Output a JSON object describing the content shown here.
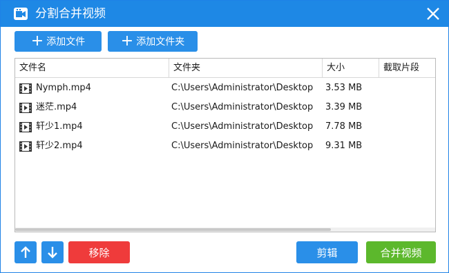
{
  "window": {
    "title": "分割合并视频",
    "accent_color": "#1e88e5",
    "icon": "app-video-icon",
    "close_icon": "close-icon"
  },
  "toolbar": {
    "add_file_label": "添加文件",
    "add_folder_label": "添加文件夹",
    "plus_glyph": "+"
  },
  "table": {
    "columns": [
      "文件名",
      "文件夹",
      "大小",
      "截取片段"
    ],
    "rows": [
      {
        "name": "Nymph.mp4",
        "folder": "C:\\Users\\Administrator\\Desktop",
        "size": "3.53 MB",
        "clip": ""
      },
      {
        "name": "迷茫.mp4",
        "folder": "C:\\Users\\Administrator\\Desktop",
        "size": "3.39 MB",
        "clip": ""
      },
      {
        "name": "轩少1.mp4",
        "folder": "C:\\Users\\Administrator\\Desktop",
        "size": "7.78 MB",
        "clip": ""
      },
      {
        "name": "轩少2.mp4",
        "folder": "C:\\Users\\Administrator\\Desktop",
        "size": "9.31 MB",
        "clip": ""
      }
    ],
    "row_icon": "video-file-icon"
  },
  "footer": {
    "up_icon": "arrow-up-icon",
    "down_icon": "arrow-down-icon",
    "remove_label": "移除",
    "edit_label": "剪辑",
    "merge_label": "合并视频",
    "remove_color": "#ef3b3b",
    "merge_color": "#5cb82c"
  }
}
